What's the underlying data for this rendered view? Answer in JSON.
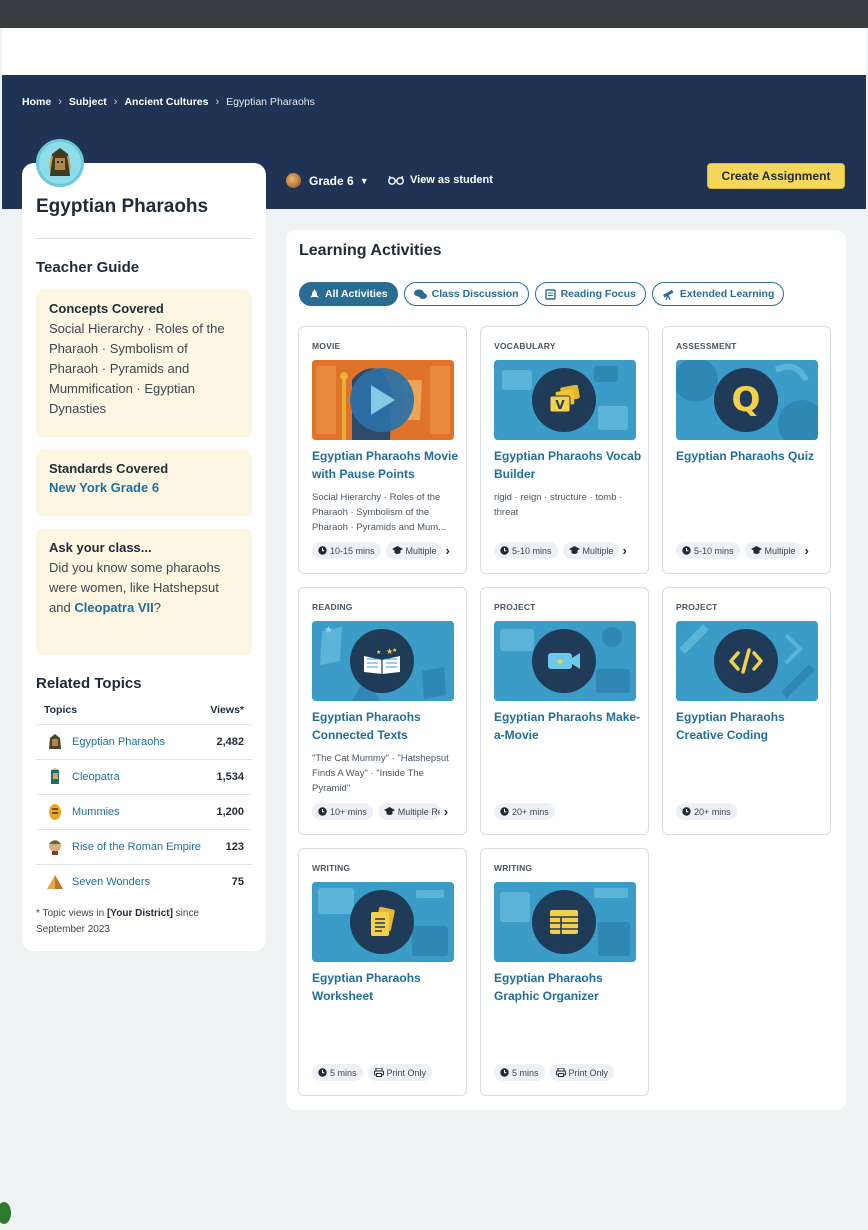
{
  "breadcrumb": [
    "Home",
    "Subject",
    "Ancient Cultures",
    "Egyptian Pharaohs"
  ],
  "header": {
    "grade": "Grade 6",
    "view_as_student": "View as student",
    "create_assignment": "Create Assignment"
  },
  "sidebar": {
    "title": "Egyptian Pharaohs",
    "teacher_guide": "Teacher Guide",
    "concepts_heading": "Concepts Covered",
    "concepts_text": "Social Hierarchy · Roles of the Pharaoh · Symbolism of Pharaoh · Pyramids and Mummification · Egyptian Dynasties",
    "standards_heading": "Standards Covered",
    "standards_link": "New York Grade 6",
    "ask_heading": "Ask your class...",
    "ask_text": "Did you know some pharaohs were women, like Hatshepsut and ",
    "ask_link": "Cleopatra VII",
    "ask_end": "?",
    "related_heading": "Related Topics",
    "col_topics": "Topics",
    "col_views": "Views*",
    "related": [
      {
        "name": "Egyptian Pharaohs",
        "views": "2,482",
        "icon": "pharaoh-icon"
      },
      {
        "name": "Cleopatra",
        "views": "1,534",
        "icon": "cleopatra-icon"
      },
      {
        "name": "Mummies",
        "views": "1,200",
        "icon": "mummy-icon"
      },
      {
        "name": "Rise of the Roman Empire",
        "views": "123",
        "icon": "roman-icon"
      },
      {
        "name": "Seven Wonders",
        "views": "75",
        "icon": "pyramid-icon"
      }
    ],
    "footnote_pre": "* Topic views in ",
    "footnote_bold": "[Your District]",
    "footnote_post": " since September 2023"
  },
  "main": {
    "heading": "Learning Activities",
    "filters": [
      "All Activities",
      "Class Discussion",
      "Reading Focus",
      "Extended Learning"
    ],
    "cards": [
      {
        "type": "MOVIE",
        "title": "Egyptian Pharaohs Movie with Pause Points",
        "desc": "Social Hierarchy · Roles of the Pharaoh · Symbolism of the Pharaoh · Pyramids and Mum...",
        "time": "10-15 mins",
        "chip2": "Multiple",
        "icon": "play-icon"
      },
      {
        "type": "VOCABULARY",
        "title": "Egyptian Pharaohs Vocab Builder",
        "desc": "rigid · reign · structure · tomb · threat",
        "time": "5-10 mins",
        "chip2": "Multiple",
        "icon": "vocab-cards-icon"
      },
      {
        "type": "ASSESSMENT",
        "title": "Egyptian Pharaohs Quiz",
        "desc": "",
        "time": "5-10 mins",
        "chip2": "Multiple",
        "icon": "quiz-q-icon"
      },
      {
        "type": "READING",
        "title": "Egyptian Pharaohs Connected Texts",
        "desc": "\"The Cat Mummy\" · \"Hatshepsut Finds A Way\" · \"Inside The Pyramid\"",
        "time": "10+ mins",
        "chip2": "Multiple Re",
        "icon": "open-book-icon"
      },
      {
        "type": "PROJECT",
        "title": "Egyptian Pharaohs Make-a-Movie",
        "desc": "",
        "time": "20+ mins",
        "chip2": "",
        "icon": "video-camera-icon"
      },
      {
        "type": "PROJECT",
        "title": "Egyptian Pharaohs Creative Coding",
        "desc": "",
        "time": "20+ mins",
        "chip2": "",
        "icon": "code-icon"
      },
      {
        "type": "WRITING",
        "title": "Egyptian Pharaohs Worksheet",
        "desc": "",
        "time": "5 mins",
        "chip2": "Print Only",
        "icon": "worksheet-icon"
      },
      {
        "type": "WRITING",
        "title": "Egyptian Pharaohs Graphic Organizer",
        "desc": "",
        "time": "5 mins",
        "chip2": "Print Only",
        "icon": "organizer-icon"
      }
    ]
  },
  "colors": {
    "navy": "#1f3355",
    "accent_blue": "#2a6d93",
    "link": "#1f6e9a",
    "button_yellow": "#f6d75a",
    "thumb_blue": "#3a9cc7",
    "cream": "#fdf6e3"
  }
}
